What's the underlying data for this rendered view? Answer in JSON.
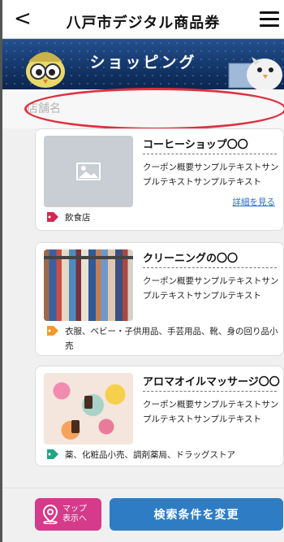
{
  "header": {
    "title": "八戸市デジタル商品券",
    "back_icon": "chevron-left-icon",
    "menu_icon": "hamburger-menu-icon"
  },
  "banner": {
    "text": "ショッピング"
  },
  "search": {
    "placeholder": "店舗名",
    "value": ""
  },
  "cards": [
    {
      "name": "コーヒーショップ〇〇",
      "description": "クーポン概要サンプルテキストサンプルテキストサンプルテキスト",
      "link": "詳細を見る",
      "category": "飲食店",
      "tag_color": "#d0284f",
      "image": "placeholder"
    },
    {
      "name": "クリーニングの〇〇",
      "description": "クーポン概要サンプルテキストサンプルテキストサンプルテキスト",
      "category": "衣服、ベビー・子供用品、手芸用品、靴、身の回り品小売",
      "tag_color": "#f29a2e",
      "image": "clothes-rack"
    },
    {
      "name": "アロマオイルマッサージ〇〇",
      "description": "クーポン概要サンプルテキストサンプルテキストサンプルテキスト",
      "category": "薬、化粧品小売、調剤薬局、ドラッグストア",
      "tag_color": "#1fa587",
      "image": "aroma-flowers"
    }
  ],
  "bottom": {
    "map_button_line1": "マップ",
    "map_button_line2": "表示へ",
    "search_button": "検索条件を変更",
    "map_color": "#d63a8a",
    "search_color": "#2e7dc4"
  },
  "annotation_color": "#e03040"
}
